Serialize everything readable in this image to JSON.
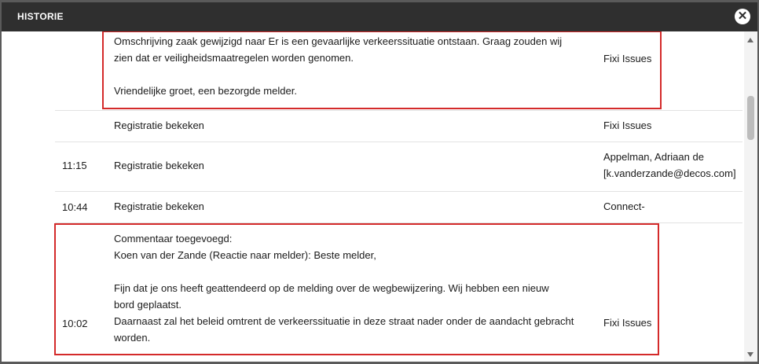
{
  "dialog": {
    "title": "HISTORIE",
    "close_icon": "close-icon"
  },
  "colors": {
    "titlebar": "#2f2f2f",
    "highlight_border": "#d42a2a"
  },
  "entries": [
    {
      "time": "",
      "description": [
        "Omschrijving zaak gewijzigd naar Er is een gevaarlijke verkeerssituatie ontstaan. Graag zouden wij",
        "zien dat er veiligheidsmaatregelen worden genomen.",
        "",
        "Vriendelijke groet, een bezorgde melder."
      ],
      "user": [
        "Fixi Issues"
      ],
      "highlighted": true
    },
    {
      "time": "",
      "description": [
        "Registratie bekeken"
      ],
      "user": [
        "Fixi Issues"
      ],
      "highlighted": false
    },
    {
      "time": "11:15",
      "description": [
        "Registratie bekeken"
      ],
      "user": [
        "Appelman, Adriaan de",
        "[k.vanderzande@decos.com]"
      ],
      "highlighted": false
    },
    {
      "time": "10:44",
      "description": [
        "Registratie bekeken"
      ],
      "user": [
        "Connect-"
      ],
      "highlighted": false
    },
    {
      "time": "10:02",
      "description": [
        "Commentaar toegevoegd:",
        "Koen van der Zande (Reactie naar melder): Beste melder,",
        "",
        "Fijn dat je ons heeft geattendeerd op de melding over de wegbewijzering. Wij hebben een nieuw",
        "bord geplaatst.",
        "Daarnaast zal het beleid omtrent de verkeerssituatie in deze straat nader onder de aandacht gebracht",
        "worden."
      ],
      "user": [
        "Fixi Issues"
      ],
      "highlighted": true
    }
  ]
}
